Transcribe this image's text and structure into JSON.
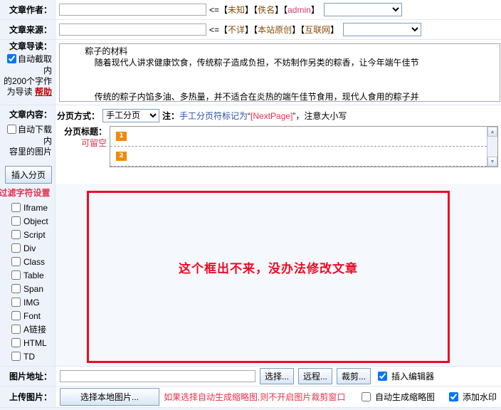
{
  "rows": {
    "author": {
      "label": "文章作者：",
      "value": "",
      "arrow": "<=",
      "links": [
        "未知",
        "佚名",
        "admin"
      ],
      "select_value": ""
    },
    "source": {
      "label": "文章来源：",
      "value": "",
      "arrow": "<=",
      "links": [
        "不详",
        "本站原创",
        "互联网"
      ],
      "select_value": ""
    },
    "summary": {
      "label": "文章导读：",
      "auto_checkbox_checked": true,
      "note_line1": "自动截取内",
      "note_line2": "的200个字作",
      "note_line3": "为导读",
      "help_label": "帮助",
      "textarea_value": "          粽子的材料\n              随着现代人讲求健康饮食，传统粽子造成负担，不妨制作另类的粽香，让今年端午佳节\n\n\n              传统的粽子内馅多油、多热量，并不适合在炎热的端午佳节食用，现代人食用的粽子并"
    },
    "content": {
      "label": "文章内容：",
      "download_images_checked": false,
      "download_note_line1": "自动下载内",
      "download_note_line2": "容里的图片",
      "insert_page_button": "插入分页",
      "paging_mode_label": "分页方式：",
      "paging_mode_value": "手工分页",
      "paging_mode_options": [
        "手工分页"
      ],
      "note_prefix": "注：",
      "note_blue": "手工分页符标记为",
      "note_quote_open": "“",
      "note_red": "[NextPage]",
      "note_quote_close": "”",
      "note_tail": "，注意大小写",
      "page_title_label": "分页标题：",
      "page_title_optional": "可留空",
      "page_titles": [
        {
          "num": "1",
          "value": ""
        },
        {
          "num": "2",
          "value": ""
        }
      ]
    }
  },
  "filters": {
    "heading": "过滤字符设置",
    "items": [
      {
        "label": "Iframe",
        "checked": false
      },
      {
        "label": "Object",
        "checked": false
      },
      {
        "label": "Script",
        "checked": false
      },
      {
        "label": "Div",
        "checked": false
      },
      {
        "label": "Class",
        "checked": false
      },
      {
        "label": "Table",
        "checked": false
      },
      {
        "label": "Span",
        "checked": false
      },
      {
        "label": "IMG",
        "checked": false
      },
      {
        "label": "Font",
        "checked": false
      },
      {
        "label": "A链接",
        "checked": false
      },
      {
        "label": "HTML",
        "checked": false
      },
      {
        "label": "TD",
        "checked": false
      }
    ]
  },
  "editor_placeholder": {
    "message": "这个框出不来，没办法修改文章",
    "border_color": "#ee0a24",
    "text_color": "#ee0a24"
  },
  "image_url_row": {
    "label": "图片地址：",
    "value": "",
    "buttons": [
      "选择...",
      "远程...",
      "裁剪..."
    ],
    "insert_editor_label": "插入编辑器",
    "insert_editor_checked": true
  },
  "upload_row": {
    "label": "上传图片：",
    "local_button": "选择本地图片...",
    "note": "如果选择自动生成缩略图,则不开启图片裁剪窗口",
    "auto_thumb_label": "自动生成缩略图",
    "auto_thumb_checked": false,
    "watermark_label": "添加水印",
    "watermark_checked": true
  },
  "colors": {
    "accent_red": "#e8304f",
    "link_brown": "#8a4b08",
    "link_pink": "#d13b6a",
    "label_bg": "#eef3fb",
    "badge_orange": "#f08a0c"
  }
}
